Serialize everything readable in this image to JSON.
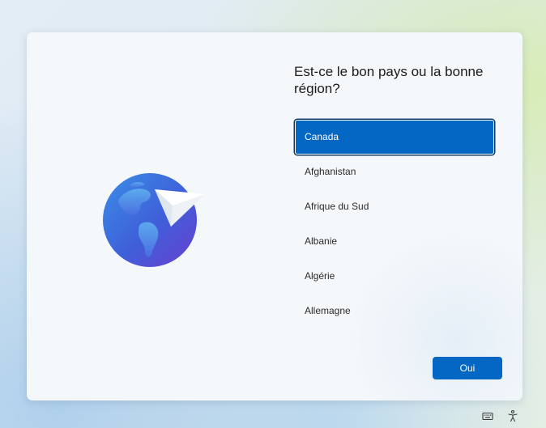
{
  "title": "Est-ce le bon pays ou la bonne région?",
  "countries": [
    {
      "label": "Canada"
    },
    {
      "label": "Afghanistan"
    },
    {
      "label": "Afrique du Sud"
    },
    {
      "label": "Albanie"
    },
    {
      "label": "Algérie"
    },
    {
      "label": "Allemagne"
    }
  ],
  "selected_country": "Canada",
  "confirm_button": {
    "label": "Oui"
  },
  "icons": {
    "illustration": "globe-with-paper-plane-icon",
    "tray_left": "keyboard-icon",
    "tray_right": "accessibility-icon"
  },
  "colors": {
    "accent": "#0567c4",
    "selected_border": "#0b3a6a",
    "card_background": "#f5f8fb"
  }
}
